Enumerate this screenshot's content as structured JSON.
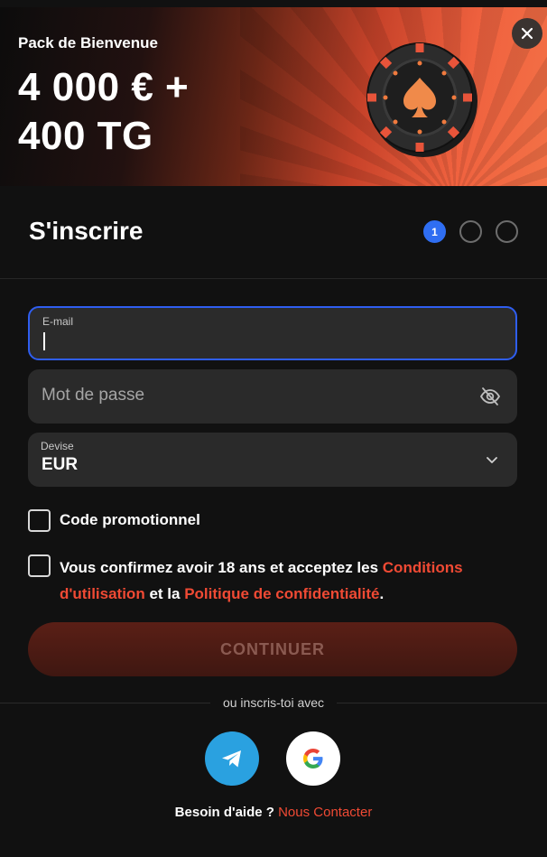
{
  "banner": {
    "subtitle": "Pack de Bienvenue",
    "title_line1": "4 000 € +",
    "title_line2": "400 TG"
  },
  "header": {
    "title": "S'inscrire",
    "steps": [
      "1",
      "",
      ""
    ],
    "current_step": 1
  },
  "form": {
    "email": {
      "label": "E-mail",
      "value": ""
    },
    "password": {
      "placeholder": "Mot de passe"
    },
    "currency": {
      "label": "Devise",
      "value": "EUR"
    },
    "promo_label": "Code promotionnel",
    "terms": {
      "text_before": "Vous confirmez avoir 18 ans et acceptez les ",
      "link_terms": "Conditions d'utilisation",
      "text_middle": " et la ",
      "link_privacy": "Politique de confidentialité",
      "text_after": "."
    },
    "continue_label": "CONTINUER"
  },
  "social": {
    "divider_text": "ou inscris-toi avec",
    "providers": [
      "telegram",
      "google"
    ]
  },
  "help": {
    "text": "Besoin d'aide ? ",
    "link": "Nous Contacter"
  },
  "colors": {
    "accent": "#f04a34",
    "step_active": "#2f6ef2",
    "focus_border": "#2f5ef0",
    "telegram": "#2aa1e0"
  },
  "icons": {
    "close": "close-icon",
    "password_toggle": "eye-slash-icon",
    "select": "chevron-down-icon",
    "telegram": "telegram-icon",
    "google": "google-icon",
    "chip": "poker-chip-spade-icon"
  }
}
